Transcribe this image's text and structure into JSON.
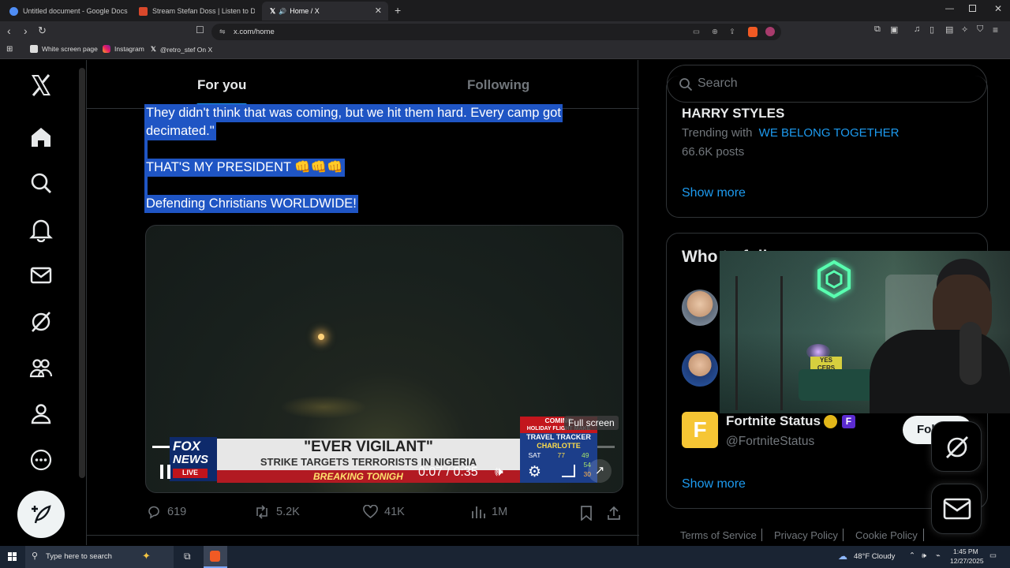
{
  "browser": {
    "tabs": [
      {
        "title": "Untitled document - Google Docs"
      },
      {
        "title": "Stream Stefan Doss | Listen to Decen"
      },
      {
        "title": "Home / X"
      }
    ],
    "url": "x.com/home",
    "bookmarks": [
      "White screen page",
      "Instagram",
      "@retro_stef On X"
    ]
  },
  "timeline": {
    "tab_for_you": "For you",
    "tab_following": "Following",
    "post_lines": [
      "They didn't think that was coming, but we hit them hard. Every camp got",
      "decimated.\"",
      "THAT'S MY PRESIDENT 👊👊👊",
      "Defending Christians WORLDWIDE!"
    ],
    "video": {
      "banner_title": "\"EVER VIGILANT\"",
      "banner_sub": "STRIKE TARGETS TERRORISTS IN NIGERIA",
      "breaking": "BREAKING TONIGH",
      "logo_top": "FOX",
      "logo_mid": "NEWS",
      "logo_live": "LIVE",
      "time": "0:07 / 0:35",
      "tooltip": "Full screen",
      "side_coming": "COMING",
      "side_holiday": "HOLIDAY FLIGHT MAKE",
      "side_tracker": "TRAVEL TRACKER",
      "side_city": "CHARLOTTE",
      "side_sat": "SAT",
      "side_sat_hi": "77",
      "side_sat_lo": "49",
      "side_row2": "54",
      "side_row3": "30"
    },
    "actions": {
      "replies": "619",
      "reposts": "5.2K",
      "likes": "41K",
      "views": "1M"
    }
  },
  "right": {
    "search_placeholder": "Search",
    "trend_title": "HARRY STYLES",
    "trend_with_label": "Trending with",
    "trend_with_tag": "WE BELONG TOGETHER",
    "trend_posts": "66.6K posts",
    "show_more": "Show more",
    "who_title": "Who to follow",
    "account_name": "Fortnite Status",
    "account_handle": "@FortniteStatus",
    "follow_label": "Follow",
    "show_more_2": "Show more",
    "footer": [
      "Terms of Service",
      "Privacy Policy",
      "Cookie Policy"
    ]
  },
  "taskbar": {
    "search_placeholder": "Type here to search",
    "weather": "48°F  Cloudy",
    "time": "1:45 PM",
    "date": "12/27/2025"
  },
  "colors": {
    "accent": "#1d9bf0",
    "selection": "#1f55c4",
    "background": "#000000"
  }
}
